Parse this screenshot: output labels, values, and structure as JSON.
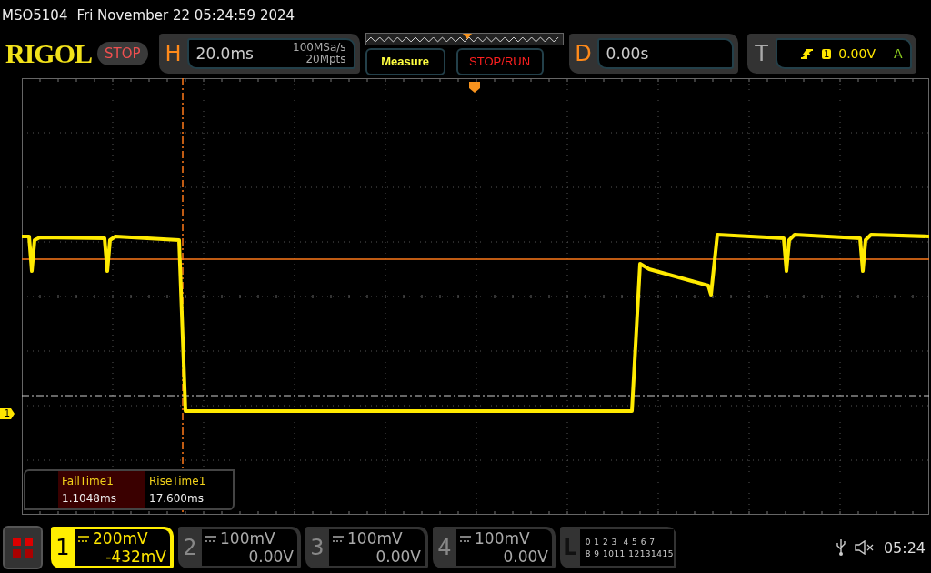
{
  "header": {
    "model": "MSO5104",
    "datetime": "Fri November 22 05:24:59 2024"
  },
  "toolbar": {
    "logo": "RIGOL",
    "run_state": "STOP",
    "horizontal": {
      "letter": "H",
      "scale": "20.0ms",
      "sample_rate": "100MSa/s",
      "memory_depth": "20Mpts"
    },
    "buttons": [
      {
        "label": "Measure",
        "kind": "menu"
      },
      {
        "label": "STOP/RUN",
        "kind": "action"
      }
    ],
    "delay": {
      "letter": "D",
      "value": "0.00s"
    },
    "trigger": {
      "letter": "T",
      "source": "1",
      "level": "0.00V",
      "mode": "A"
    }
  },
  "screen": {
    "channel_marker": "1"
  },
  "measurements": [
    {
      "label": "FallTime1",
      "value": "1.1048ms",
      "selected": true
    },
    {
      "label": "RiseTime1",
      "value": "17.600ms",
      "selected": false
    }
  ],
  "channels": [
    {
      "number": "1",
      "scale": "200mV",
      "offset": "-432mV",
      "on": true
    },
    {
      "number": "2",
      "scale": "100mV",
      "offset": "0.00V",
      "on": false
    },
    {
      "number": "3",
      "scale": "100mV",
      "offset": "0.00V",
      "on": false
    },
    {
      "number": "4",
      "scale": "100mV",
      "offset": "0.00V",
      "on": false
    }
  ],
  "logic": {
    "letter": "L",
    "rows": [
      "0 1 2 3  4 5 6 7",
      "8 9 1011 12131415"
    ]
  },
  "status_bar": {
    "time": "05:24"
  }
}
